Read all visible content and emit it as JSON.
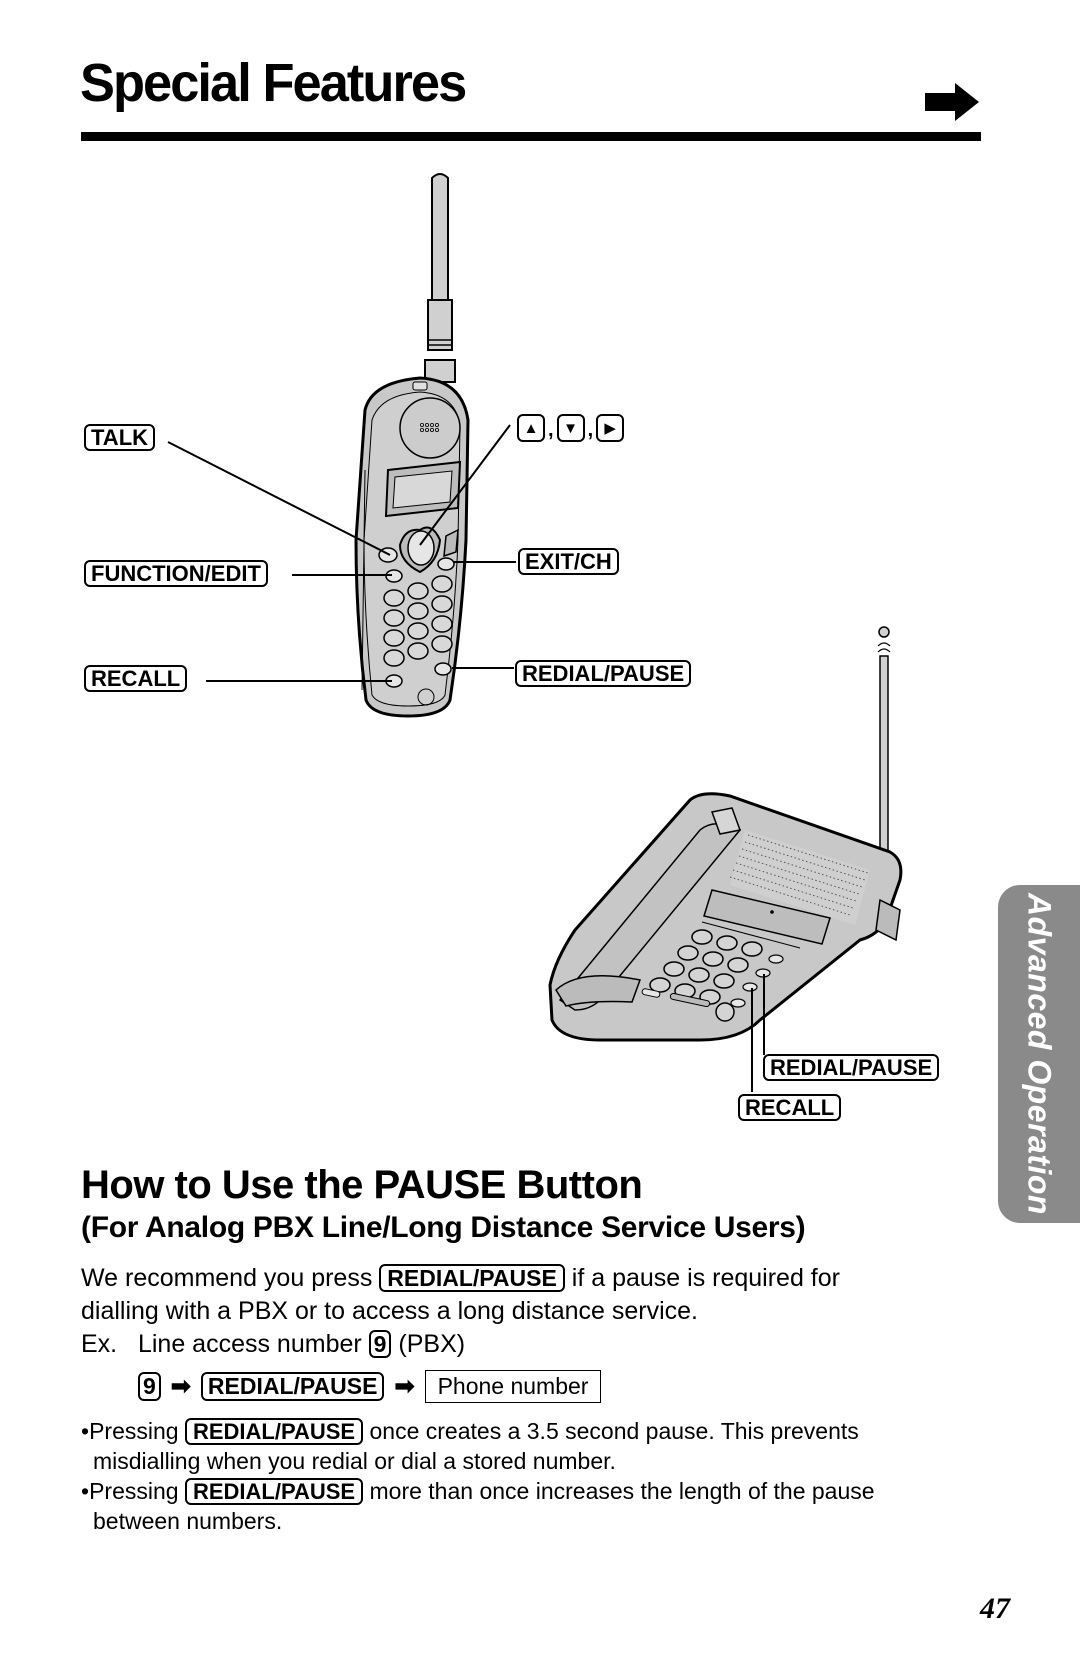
{
  "header": {
    "title": "Special Features",
    "continue_icon": "right-arrow-icon"
  },
  "side_tab": {
    "label": "Advanced Operation",
    "color": "#8a8a8a"
  },
  "handset_callouts": {
    "talk": "TALK",
    "function_edit": "FUNCTION/EDIT",
    "recall": "RECALL",
    "navigation_keys": [
      "▲",
      "▼",
      "▶"
    ],
    "navigation_key_names": [
      "up-arrow-key-icon",
      "down-arrow-key-icon",
      "right-arrow-key-icon"
    ],
    "exit_ch": "EXIT/CH",
    "redial_pause": "REDIAL/PAUSE"
  },
  "base_callouts": {
    "redial_pause": "REDIAL/PAUSE",
    "recall": "RECALL"
  },
  "section": {
    "heading": "How to Use the PAUSE Button",
    "subheading": "(For Analog PBX Line/Long Distance Service Users)",
    "intro_before_key": "We recommend you press",
    "intro_key": "REDIAL/PAUSE",
    "intro_after_key": "if a pause is required for",
    "intro_line2": "dialling with a PBX or to access a long distance service.",
    "example_prefix": "Ex.",
    "example_text": "Line access number",
    "example_key": "9",
    "example_suffix": "(PBX)",
    "sequence": {
      "step1_key": "9",
      "arrow": "➡",
      "step2_key": "REDIAL/PAUSE",
      "step3_box": "Phone number"
    },
    "notes": [
      {
        "bullet": "•",
        "before_key": "Pressing",
        "key": "REDIAL/PAUSE",
        "after_key": "once creates a 3.5 second pause. This prevents",
        "continuation": "misdialling when you redial or dial a stored number."
      },
      {
        "bullet": "•",
        "before_key": "Pressing",
        "key": "REDIAL/PAUSE",
        "after_key": "more than once increases the length of the pause",
        "continuation": "between numbers."
      }
    ]
  },
  "footer": {
    "page_number": "47"
  }
}
